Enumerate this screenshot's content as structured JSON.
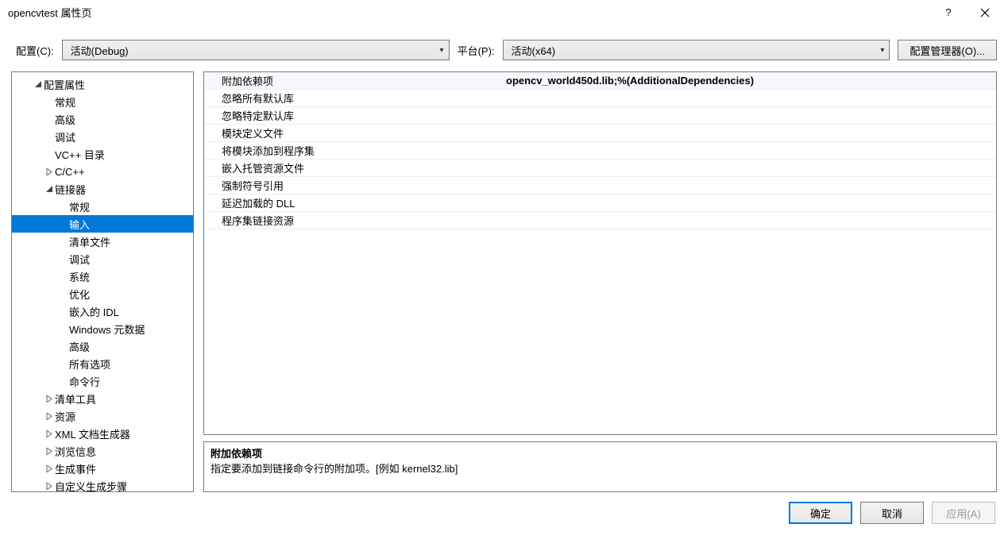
{
  "title": "opencvtest 属性页",
  "toolbar": {
    "config_label": "配置(C):",
    "config_value": "活动(Debug)",
    "platform_label": "平台(P):",
    "platform_value": "活动(x64)",
    "config_mgr_label": "配置管理器(O)..."
  },
  "tree": {
    "root": "配置属性",
    "items_lvl2": [
      "常规",
      "高级",
      "调试",
      "VC++ 目录"
    ],
    "cxx": "C/C++",
    "linker": "链接器",
    "linker_children": [
      "常规",
      "输入",
      "清单文件",
      "调试",
      "系统",
      "优化",
      "嵌入的 IDL",
      "Windows 元数据",
      "高级",
      "所有选项",
      "命令行"
    ],
    "linker_selected": "输入",
    "rest": [
      "清单工具",
      "资源",
      "XML 文档生成器",
      "浏览信息",
      "生成事件",
      "自定义生成步骤"
    ]
  },
  "grid": [
    {
      "label": "附加依赖项",
      "value": "opencv_world450d.lib;%(AdditionalDependencies)"
    },
    {
      "label": "忽略所有默认库",
      "value": ""
    },
    {
      "label": "忽略特定默认库",
      "value": ""
    },
    {
      "label": "模块定义文件",
      "value": ""
    },
    {
      "label": "将模块添加到程序集",
      "value": ""
    },
    {
      "label": "嵌入托管资源文件",
      "value": ""
    },
    {
      "label": "强制符号引用",
      "value": ""
    },
    {
      "label": "延迟加载的 DLL",
      "value": ""
    },
    {
      "label": "程序集链接资源",
      "value": ""
    }
  ],
  "desc": {
    "title": "附加依赖项",
    "body": "指定要添加到链接命令行的附加项。[例如 kernel32.lib]"
  },
  "footer": {
    "ok": "确定",
    "cancel": "取消",
    "apply": "应用(A)"
  }
}
